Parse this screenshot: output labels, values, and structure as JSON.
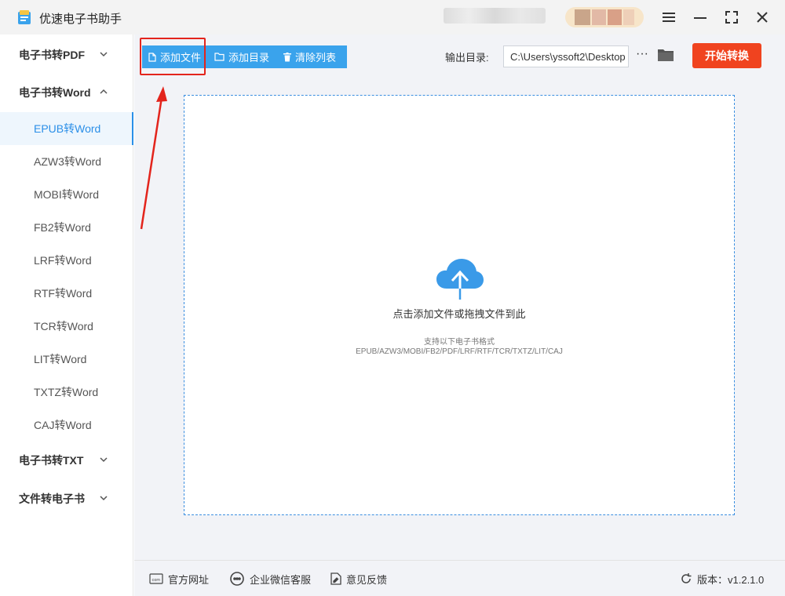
{
  "window": {
    "title": "优速电子书助手"
  },
  "sidebar": {
    "groups": [
      {
        "label": "电子书转PDF",
        "expanded": false
      },
      {
        "label": "电子书转Word",
        "expanded": true
      },
      {
        "label": "电子书转TXT",
        "expanded": false
      },
      {
        "label": "文件转电子书",
        "expanded": false
      }
    ],
    "word_items": [
      {
        "label": "EPUB转Word",
        "active": true
      },
      {
        "label": "AZW3转Word"
      },
      {
        "label": "MOBI转Word"
      },
      {
        "label": "FB2转Word"
      },
      {
        "label": "LRF转Word"
      },
      {
        "label": "RTF转Word"
      },
      {
        "label": "TCR转Word"
      },
      {
        "label": "LIT转Word"
      },
      {
        "label": "TXTZ转Word"
      },
      {
        "label": "CAJ转Word"
      }
    ]
  },
  "toolbar": {
    "add_file": "添加文件",
    "add_folder": "添加目录",
    "clear_list": "清除列表",
    "output_label": "输出目录:",
    "output_path": "C:\\Users\\yssoft2\\Desktop",
    "more": "···",
    "start": "开始转换"
  },
  "dropzone": {
    "hint": "点击添加文件或拖拽文件到此",
    "support_label": "支持以下电子书格式",
    "formats": "EPUB/AZW3/MOBI/FB2/PDF/LRF/RTF/TCR/TXTZ/LIT/CAJ"
  },
  "footer": {
    "website": "官方网址",
    "wechat_service": "企业微信客服",
    "feedback": "意见反馈",
    "version": "版本：v1.2.1.0"
  },
  "colors": {
    "accent": "#3aa3ec",
    "start_button": "#f0431f",
    "annotation": "#e3241c",
    "active_item": "#2b8fe8"
  }
}
